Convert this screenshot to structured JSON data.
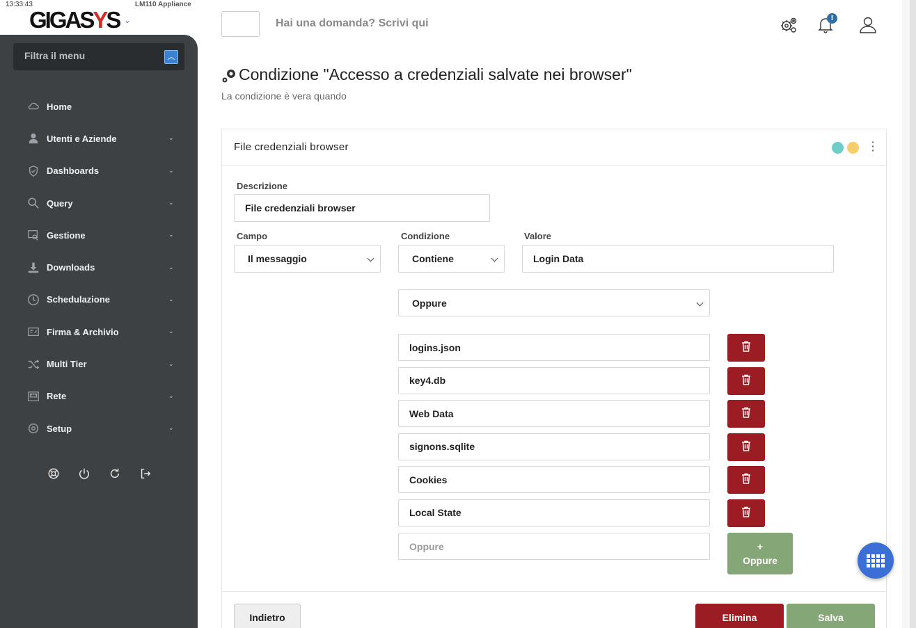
{
  "status": {
    "clock": "13:33:43",
    "appliance": "LM110 Appliance"
  },
  "brand": {
    "logo_main": "GIGAS",
    "logo_accent": "Y",
    "logo_end": "S"
  },
  "sidebar": {
    "filter_label": "Filtra il menu",
    "items": [
      {
        "label": "Home",
        "icon": "cloud-icon",
        "has_children": false
      },
      {
        "label": "Utenti e Aziende",
        "icon": "user-icon",
        "has_children": true
      },
      {
        "label": "Dashboards",
        "icon": "shield-icon",
        "has_children": true
      },
      {
        "label": "Query",
        "icon": "search-icon",
        "has_children": true
      },
      {
        "label": "Gestione",
        "icon": "manage-icon",
        "has_children": true
      },
      {
        "label": "Downloads",
        "icon": "download-icon",
        "has_children": true
      },
      {
        "label": "Schedulazione",
        "icon": "clock-icon",
        "has_children": true
      },
      {
        "label": "Firma & Archivio",
        "icon": "archive-icon",
        "has_children": true
      },
      {
        "label": "Multi Tier",
        "icon": "shuffle-icon",
        "has_children": true
      },
      {
        "label": "Rete",
        "icon": "network-icon",
        "has_children": true
      },
      {
        "label": "Setup",
        "icon": "setup-icon",
        "has_children": true
      }
    ],
    "chevron": "⌄",
    "actions": [
      "help-icon",
      "power-icon",
      "refresh-icon",
      "logout-icon"
    ]
  },
  "topbar": {
    "ask_placeholder": "Hai una domanda? Scrivi qui",
    "notification_badge": "!"
  },
  "page": {
    "title": "Condizione \"Accesso a credenziali salvate nei browser\"",
    "subtitle": "La condizione è vera quando"
  },
  "card": {
    "title": "File credenziali browser",
    "status_dots": [
      "#6fcdc9",
      "#f5cd6a"
    ],
    "form": {
      "descrizione_label": "Descrizione",
      "descrizione_value": "File credenziali browser",
      "campo_label": "Campo",
      "campo_value": "Il messaggio",
      "condizione_label": "Condizione",
      "condizione_value": "Contiene",
      "valore_label": "Valore",
      "valore_value": "Login Data",
      "operator_value": "Oppure",
      "or_values": [
        "logins.json",
        "key4.db",
        "Web Data",
        "signons.sqlite",
        "Cookies",
        "Local State"
      ],
      "new_or_placeholder": "Oppure",
      "add_or_plus": "+",
      "add_or_label": "Oppure"
    },
    "footer": {
      "back_label": "Indietro",
      "delete_label": "Elimina",
      "save_label": "Salva"
    }
  },
  "colors": {
    "sidebar_bg": "#3d4144",
    "danger": "#9b1c22",
    "success": "#85a777",
    "accent": "#3b6fd6"
  }
}
